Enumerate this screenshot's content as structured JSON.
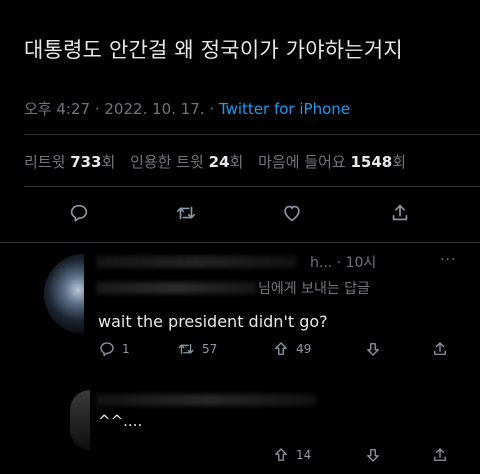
{
  "tweet": {
    "text": "대통령도 안간걸 왜 정국이가 가야하는거지",
    "time": "오후 4:27",
    "date": "2022. 10. 17.",
    "source": "Twitter for iPhone"
  },
  "stats": {
    "retweets_label": "리트윗",
    "retweets": "733",
    "retweets_unit": "회",
    "quotes_label": "인용한 트윗",
    "quotes": "24",
    "quotes_unit": "회",
    "likes_label": "마음에 들어요",
    "likes": "1548",
    "likes_unit": "회"
  },
  "actions": {
    "reply_icon": "comment-icon",
    "retweet_icon": "retweet-icon",
    "like_icon": "heart-icon",
    "share_icon": "share-icon"
  },
  "replies": [
    {
      "handle_tail": "h...",
      "time": "10시",
      "reply_to_suffix": "님에게 보내는 답글",
      "text": "wait the president didn't go?",
      "reply_count": "1",
      "retweet_count": "57",
      "upvote_count": "49"
    },
    {
      "text": "^^....",
      "upvote_count": "14"
    }
  ],
  "colors": {
    "background": "#000000",
    "text": "#e7e9ea",
    "secondary": "#71767b",
    "accent": "#1d9bf0",
    "divider": "#2f3336"
  }
}
